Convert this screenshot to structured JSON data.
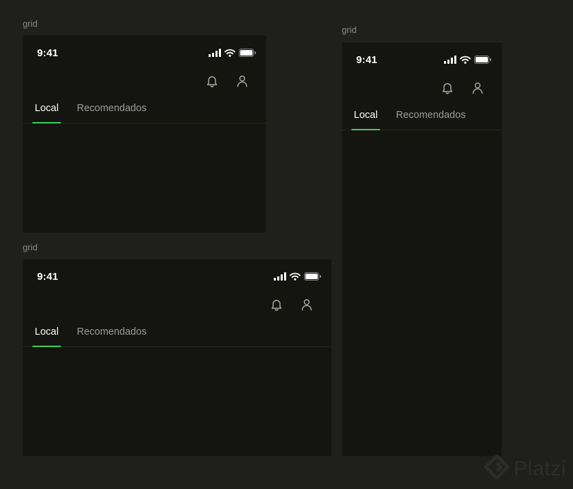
{
  "frames": [
    {
      "label": "grid",
      "status_time": "9:41",
      "tabs": [
        {
          "label": "Local",
          "active": true
        },
        {
          "label": "Recomendados",
          "active": false
        }
      ]
    },
    {
      "label": "grid",
      "status_time": "9:41",
      "tabs": [
        {
          "label": "Local",
          "active": true
        },
        {
          "label": "Recomendados",
          "active": false
        }
      ]
    },
    {
      "label": "grid",
      "status_time": "9:41",
      "tabs": [
        {
          "label": "Local",
          "active": true
        },
        {
          "label": "Recomendados",
          "active": false
        }
      ]
    }
  ],
  "watermark": {
    "text": "Platzi"
  },
  "colors": {
    "canvas_bg": "#1f1f1d",
    "frame_bg": "#141510",
    "accent": "#3fcf5f",
    "text_active": "#ffffff",
    "text_inactive": "#9c9c98",
    "label_text": "#8a8a86"
  },
  "icons": [
    "cellular-signal-icon",
    "wifi-icon",
    "battery-icon",
    "bell-icon",
    "user-icon",
    "platzi-logo-icon"
  ]
}
